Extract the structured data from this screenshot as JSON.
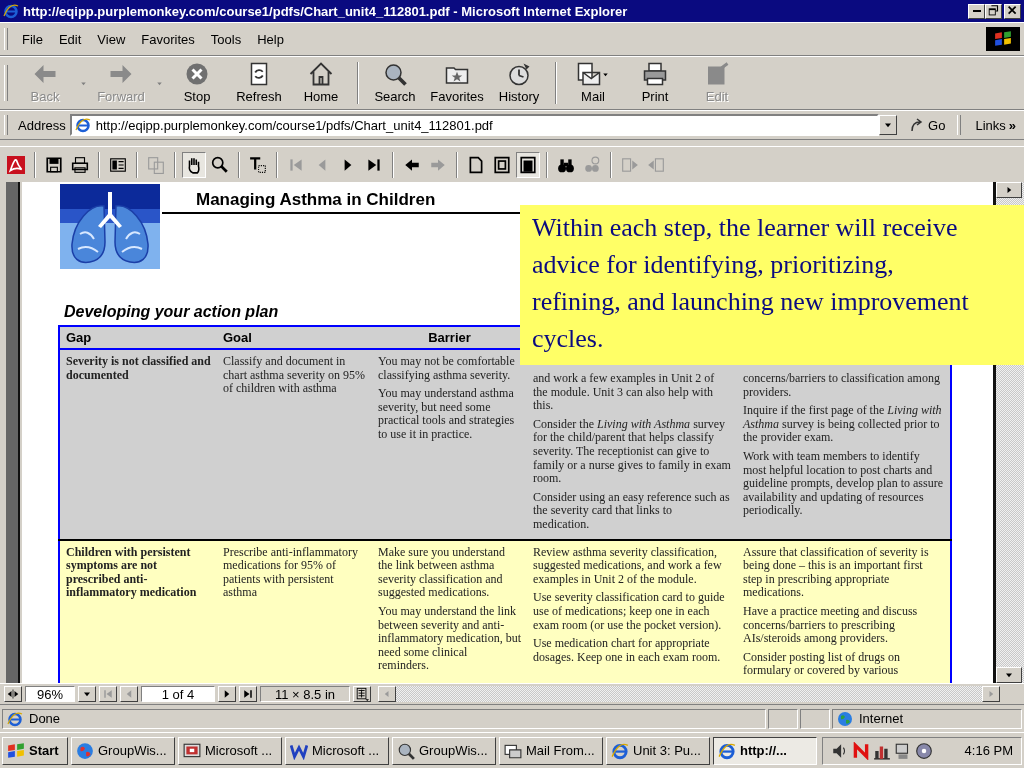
{
  "window": {
    "title": "http://eqipp.purplemonkey.com/course1/pdfs/Chart_unit4_112801.pdf - Microsoft Internet Explorer"
  },
  "menu": [
    "File",
    "Edit",
    "View",
    "Favorites",
    "Tools",
    "Help"
  ],
  "toolbar": [
    {
      "label": "Back",
      "kind": "back",
      "disabled": true,
      "dropdown": true
    },
    {
      "label": "Forward",
      "kind": "forward",
      "disabled": true,
      "dropdown": true
    },
    {
      "label": "Stop",
      "kind": "stop",
      "disabled": false,
      "dropdown": false
    },
    {
      "label": "Refresh",
      "kind": "refresh",
      "disabled": false,
      "dropdown": false
    },
    {
      "label": "Home",
      "kind": "home",
      "disabled": false,
      "dropdown": false
    },
    {
      "kind": "separator"
    },
    {
      "label": "Search",
      "kind": "search",
      "disabled": false,
      "dropdown": false
    },
    {
      "label": "Favorites",
      "kind": "favorites",
      "disabled": false,
      "dropdown": false
    },
    {
      "label": "History",
      "kind": "history",
      "disabled": false,
      "dropdown": false
    },
    {
      "kind": "separator"
    },
    {
      "label": "Mail",
      "kind": "mail",
      "disabled": false,
      "dropdown": true
    },
    {
      "label": "Print",
      "kind": "print",
      "disabled": false,
      "dropdown": false
    },
    {
      "label": "Edit",
      "kind": "edit",
      "disabled": true,
      "dropdown": false
    }
  ],
  "address_bar": {
    "label": "Address",
    "value": "http://eqipp.purplemonkey.com/course1/pdfs/Chart_unit4_112801.pdf",
    "go": "Go",
    "links": "Links",
    "links_more": "»"
  },
  "pdf_toolbar": [
    {
      "kind": "logo",
      "disabled": false,
      "pressed": false
    },
    {
      "kind": "separator"
    },
    {
      "kind": "save",
      "disabled": false,
      "pressed": false
    },
    {
      "kind": "print",
      "disabled": false,
      "pressed": false
    },
    {
      "kind": "separator"
    },
    {
      "kind": "pane",
      "disabled": false,
      "pressed": false
    },
    {
      "kind": "separator"
    },
    {
      "kind": "copy",
      "disabled": true,
      "pressed": false
    },
    {
      "kind": "separator"
    },
    {
      "kind": "hand",
      "disabled": false,
      "pressed": true
    },
    {
      "kind": "zoom",
      "disabled": false,
      "pressed": false
    },
    {
      "kind": "separator"
    },
    {
      "kind": "textsel",
      "disabled": false,
      "pressed": false
    },
    {
      "kind": "separator"
    },
    {
      "kind": "first",
      "disabled": true,
      "pressed": false
    },
    {
      "kind": "prev",
      "disabled": true,
      "pressed": false
    },
    {
      "kind": "next",
      "disabled": false,
      "pressed": false
    },
    {
      "kind": "last",
      "disabled": false,
      "pressed": false
    },
    {
      "kind": "separator"
    },
    {
      "kind": "goback",
      "disabled": false,
      "pressed": false
    },
    {
      "kind": "gofwd",
      "disabled": true,
      "pressed": false
    },
    {
      "kind": "separator"
    },
    {
      "kind": "page",
      "disabled": false,
      "pressed": false
    },
    {
      "kind": "fitpage",
      "disabled": false,
      "pressed": false
    },
    {
      "kind": "fitwidth",
      "disabled": false,
      "pressed": true
    },
    {
      "kind": "separator"
    },
    {
      "kind": "find",
      "disabled": false,
      "pressed": false
    },
    {
      "kind": "websearch",
      "disabled": true,
      "pressed": false
    },
    {
      "kind": "separator"
    },
    {
      "kind": "rotl",
      "disabled": true,
      "pressed": false
    },
    {
      "kind": "rotr",
      "disabled": true,
      "pressed": false
    }
  ],
  "document": {
    "title": "Managing Asthma in Children",
    "section": "Developing your action plan",
    "columns": [
      "Gap",
      "Goal",
      "Barrier"
    ],
    "rows": [
      {
        "color": "#d0d0d0",
        "covered": true,
        "gap": "Severity is not classified and documented",
        "goal": "Classify and document in chart asthma severity on 95% of children with asthma",
        "barrier": [
          "You may not be comfortable classifying asthma severity.",
          "You may understand asthma severity, but need some practical tools and strategies to use it in practice."
        ],
        "column_4": [
          "and work a few examples in Unit 2 of the module. Unit 3 can also help with this.",
          "Consider the *Living with Asthma* survey for the child/parent that helps classify severity. The receptionist can give to family or a nurse gives to family in exam room.",
          "Consider using an easy reference such as the severity card that links to medication."
        ],
        "column_5": [
          "concerns/barriers to classification among providers.",
          "Inquire if the first page of the *Living with Asthma* survey is being collected prior to the provider exam.",
          "Work with team members to identify most helpful location to post charts and guideline prompts, develop plan to assure availability and updating of resources periodically."
        ]
      },
      {
        "color": "#ffffc0",
        "covered": false,
        "gap": "Children with persistent symptoms are not prescribed anti-inflammatory medication",
        "goal": "Prescribe anti-inflammatory medications for 95% of patients with persistent asthma",
        "barrier": [
          "Make sure you understand the link between asthma severity classification and suggested medications.",
          "You may understand the link between severity and anti-inflammatory medication, but need some clinical reminders."
        ],
        "column_4": [
          "Review asthma severity classification, suggested medications, and work a few examples in Unit 2 of the module.",
          "Use severity classification card to guide use of medications; keep one in each exam room (or use the pocket version).",
          "Use medication chart for appropriate dosages. Keep one in each exam room."
        ],
        "column_5": [
          "Assure that classification of severity is being done – this is an important first step in prescribing appropriate medications.",
          "Have a practice meeting and discuss concerns/barriers to prescribing AIs/steroids among providers.",
          "Consider posting list of drugs on formulary or covered by various"
        ]
      }
    ]
  },
  "callout": {
    "text": "Within each step, the learner will receive advice for identifying, prioritizing, refining, and launching new improvement cycles."
  },
  "pdf_status": {
    "zoom": "96%",
    "page": "1 of 4",
    "page_size": "11 × 8.5 in"
  },
  "status_bar": {
    "text": "Done",
    "zone": "Internet"
  },
  "taskbar": {
    "start": "Start",
    "tasks": [
      {
        "label": "GroupWis...",
        "kind": "groupwise",
        "selected": false
      },
      {
        "label": "Microsoft ...",
        "kind": "presentation",
        "selected": false
      },
      {
        "label": "Microsoft ...",
        "kind": "word",
        "selected": false
      },
      {
        "label": "GroupWis...",
        "kind": "find",
        "selected": false
      },
      {
        "label": "Mail From...",
        "kind": "mailtray",
        "selected": false
      },
      {
        "label": "Unit 3: Pu...",
        "kind": "browser",
        "selected": false
      },
      {
        "label": "http://...",
        "kind": "browser",
        "selected": true
      }
    ],
    "clock": "4:16 PM"
  }
}
